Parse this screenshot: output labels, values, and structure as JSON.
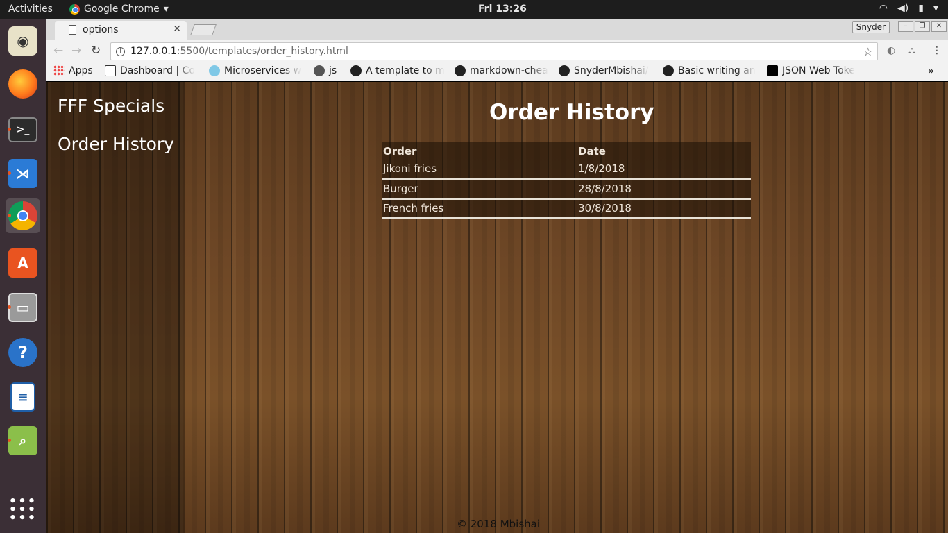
{
  "topbar": {
    "activities": "Activities",
    "app_name": "Google Chrome",
    "clock": "Fri 13:26"
  },
  "browser": {
    "tab_title": "options",
    "profile": "Snyder",
    "url_host": "127.0.0.1",
    "url_rest": ":5500/templates/order_history.html",
    "bookmarks": [
      {
        "label": "Apps",
        "icon": "apps-grid-icon"
      },
      {
        "label": "Dashboard | Co",
        "icon": "page-icon"
      },
      {
        "label": "Microservices w",
        "icon": "globe-icon"
      },
      {
        "label": "js",
        "icon": "circle-logo-icon"
      },
      {
        "label": "A template to m",
        "icon": "github-icon"
      },
      {
        "label": "markdown-chea",
        "icon": "github-icon"
      },
      {
        "label": "SnyderMbishai/",
        "icon": "github-icon"
      },
      {
        "label": "Basic writing an",
        "icon": "github-icon"
      },
      {
        "label": "JSON Web Toke",
        "icon": "jwt-icon"
      }
    ]
  },
  "page": {
    "nav": [
      "FFF Specials",
      "Order History"
    ],
    "heading": "Order History",
    "table": {
      "headers": [
        "Order",
        "Date"
      ],
      "rows": [
        [
          "Jikoni fries",
          "1/8/2018"
        ],
        [
          "Burger",
          "28/8/2018"
        ],
        [
          "French fries",
          "30/8/2018"
        ]
      ]
    },
    "footer": "© 2018 Mbishai"
  },
  "colors": {
    "topbar_bg": "#1d1d1d",
    "dock_bg": "#3b2f36",
    "accent": "#e95420",
    "wood": "#6e4726"
  }
}
